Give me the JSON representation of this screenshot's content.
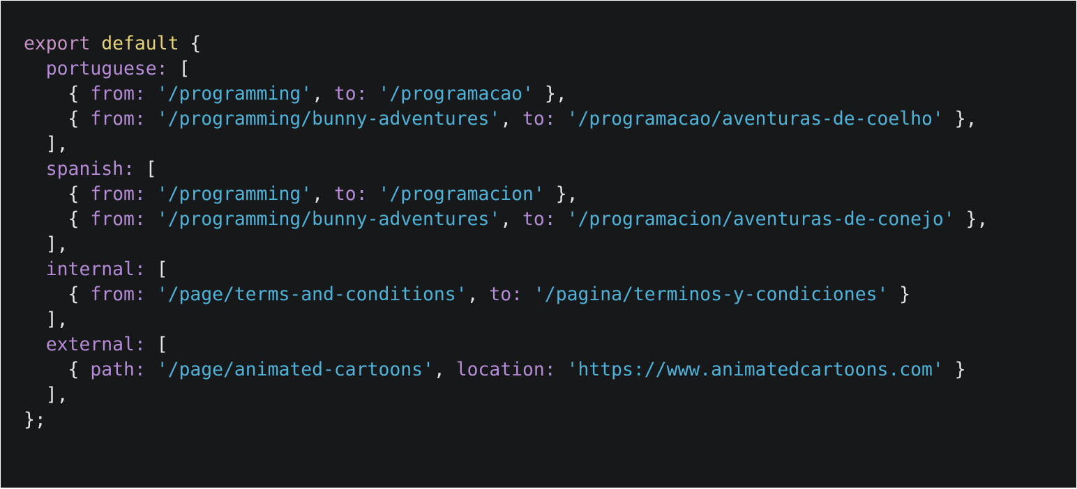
{
  "editor": {
    "theme": {
      "background": "#17181a",
      "keyword": "#c792c4",
      "default_keyword": "#e7d37a",
      "property": "#b58cd6",
      "string": "#4fb3d9",
      "punctuation": "#e6e6e6"
    },
    "lines": [
      {
        "tokens": [
          {
            "t": "kw",
            "v": "export"
          },
          {
            "t": "pun",
            "v": " "
          },
          {
            "t": "fn",
            "v": "default"
          },
          {
            "t": "pun",
            "v": " {"
          }
        ]
      },
      {
        "tokens": [
          {
            "t": "pun",
            "v": "  "
          },
          {
            "t": "prop",
            "v": "portuguese:"
          },
          {
            "t": "pun",
            "v": " ["
          }
        ]
      },
      {
        "tokens": [
          {
            "t": "pun",
            "v": "    { "
          },
          {
            "t": "prop",
            "v": "from:"
          },
          {
            "t": "pun",
            "v": " "
          },
          {
            "t": "str",
            "v": "'/programming'"
          },
          {
            "t": "pun",
            "v": ", "
          },
          {
            "t": "prop",
            "v": "to:"
          },
          {
            "t": "pun",
            "v": " "
          },
          {
            "t": "str",
            "v": "'/programacao'"
          },
          {
            "t": "pun",
            "v": " },"
          }
        ]
      },
      {
        "tokens": [
          {
            "t": "pun",
            "v": "    { "
          },
          {
            "t": "prop",
            "v": "from:"
          },
          {
            "t": "pun",
            "v": " "
          },
          {
            "t": "str",
            "v": "'/programming/bunny-adventures'"
          },
          {
            "t": "pun",
            "v": ", "
          },
          {
            "t": "prop",
            "v": "to:"
          },
          {
            "t": "pun",
            "v": " "
          },
          {
            "t": "str",
            "v": "'/programacao/aventuras-de-coelho'"
          },
          {
            "t": "pun",
            "v": " },"
          }
        ]
      },
      {
        "tokens": [
          {
            "t": "pun",
            "v": "  ],"
          }
        ]
      },
      {
        "tokens": [
          {
            "t": "pun",
            "v": "  "
          },
          {
            "t": "prop",
            "v": "spanish:"
          },
          {
            "t": "pun",
            "v": " ["
          }
        ]
      },
      {
        "tokens": [
          {
            "t": "pun",
            "v": "    { "
          },
          {
            "t": "prop",
            "v": "from:"
          },
          {
            "t": "pun",
            "v": " "
          },
          {
            "t": "str",
            "v": "'/programming'"
          },
          {
            "t": "pun",
            "v": ", "
          },
          {
            "t": "prop",
            "v": "to:"
          },
          {
            "t": "pun",
            "v": " "
          },
          {
            "t": "str",
            "v": "'/programacion'"
          },
          {
            "t": "pun",
            "v": " },"
          }
        ]
      },
      {
        "tokens": [
          {
            "t": "pun",
            "v": "    { "
          },
          {
            "t": "prop",
            "v": "from:"
          },
          {
            "t": "pun",
            "v": " "
          },
          {
            "t": "str",
            "v": "'/programming/bunny-adventures'"
          },
          {
            "t": "pun",
            "v": ", "
          },
          {
            "t": "prop",
            "v": "to:"
          },
          {
            "t": "pun",
            "v": " "
          },
          {
            "t": "str",
            "v": "'/programacion/aventuras-de-conejo'"
          },
          {
            "t": "pun",
            "v": " },"
          }
        ]
      },
      {
        "tokens": [
          {
            "t": "pun",
            "v": "  ],"
          }
        ]
      },
      {
        "tokens": [
          {
            "t": "pun",
            "v": "  "
          },
          {
            "t": "prop",
            "v": "internal:"
          },
          {
            "t": "pun",
            "v": " ["
          }
        ]
      },
      {
        "tokens": [
          {
            "t": "pun",
            "v": "    { "
          },
          {
            "t": "prop",
            "v": "from:"
          },
          {
            "t": "pun",
            "v": " "
          },
          {
            "t": "str",
            "v": "'/page/terms-and-conditions'"
          },
          {
            "t": "pun",
            "v": ", "
          },
          {
            "t": "prop",
            "v": "to:"
          },
          {
            "t": "pun",
            "v": " "
          },
          {
            "t": "str",
            "v": "'/pagina/terminos-y-condiciones'"
          },
          {
            "t": "pun",
            "v": " }"
          }
        ]
      },
      {
        "tokens": [
          {
            "t": "pun",
            "v": "  ],"
          }
        ]
      },
      {
        "tokens": [
          {
            "t": "pun",
            "v": "  "
          },
          {
            "t": "prop",
            "v": "external:"
          },
          {
            "t": "pun",
            "v": " ["
          }
        ]
      },
      {
        "tokens": [
          {
            "t": "pun",
            "v": "    { "
          },
          {
            "t": "prop",
            "v": "path:"
          },
          {
            "t": "pun",
            "v": " "
          },
          {
            "t": "str",
            "v": "'/page/animated-cartoons'"
          },
          {
            "t": "pun",
            "v": ", "
          },
          {
            "t": "prop",
            "v": "location:"
          },
          {
            "t": "pun",
            "v": " "
          },
          {
            "t": "str",
            "v": "'https://www.animatedcartoons.com'"
          },
          {
            "t": "pun",
            "v": " }"
          }
        ]
      },
      {
        "tokens": [
          {
            "t": "pun",
            "v": "  ],"
          }
        ]
      },
      {
        "tokens": [
          {
            "t": "pun",
            "v": "};"
          }
        ]
      }
    ]
  }
}
